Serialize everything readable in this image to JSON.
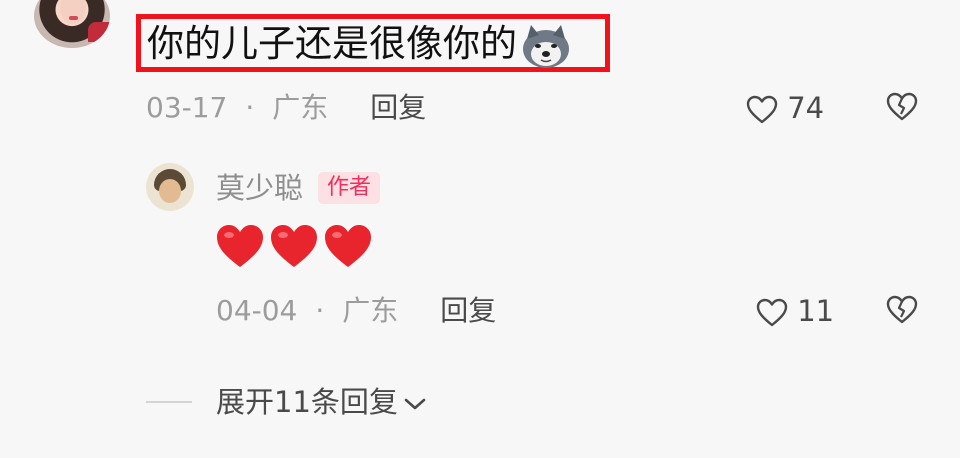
{
  "comment": {
    "text": "你的儿子还是很像你的",
    "sticker_icon": "husky-dog-sticker",
    "date": "03-17",
    "separator": "·",
    "location": "广东",
    "reply_label": "回复",
    "like_count": "74"
  },
  "reply": {
    "author": "莫少聪",
    "badge": "作者",
    "content_icons": [
      "red-heart",
      "red-heart",
      "red-heart"
    ],
    "date": "04-04",
    "separator": "·",
    "location": "广东",
    "reply_label": "回复",
    "like_count": "11"
  },
  "expand_replies": {
    "label": "展开11条回复"
  },
  "colors": {
    "highlight_box": "#f1131c",
    "badge_bg": "#fde0e4",
    "badge_text": "#f0305a",
    "heart": "#e8242c"
  }
}
